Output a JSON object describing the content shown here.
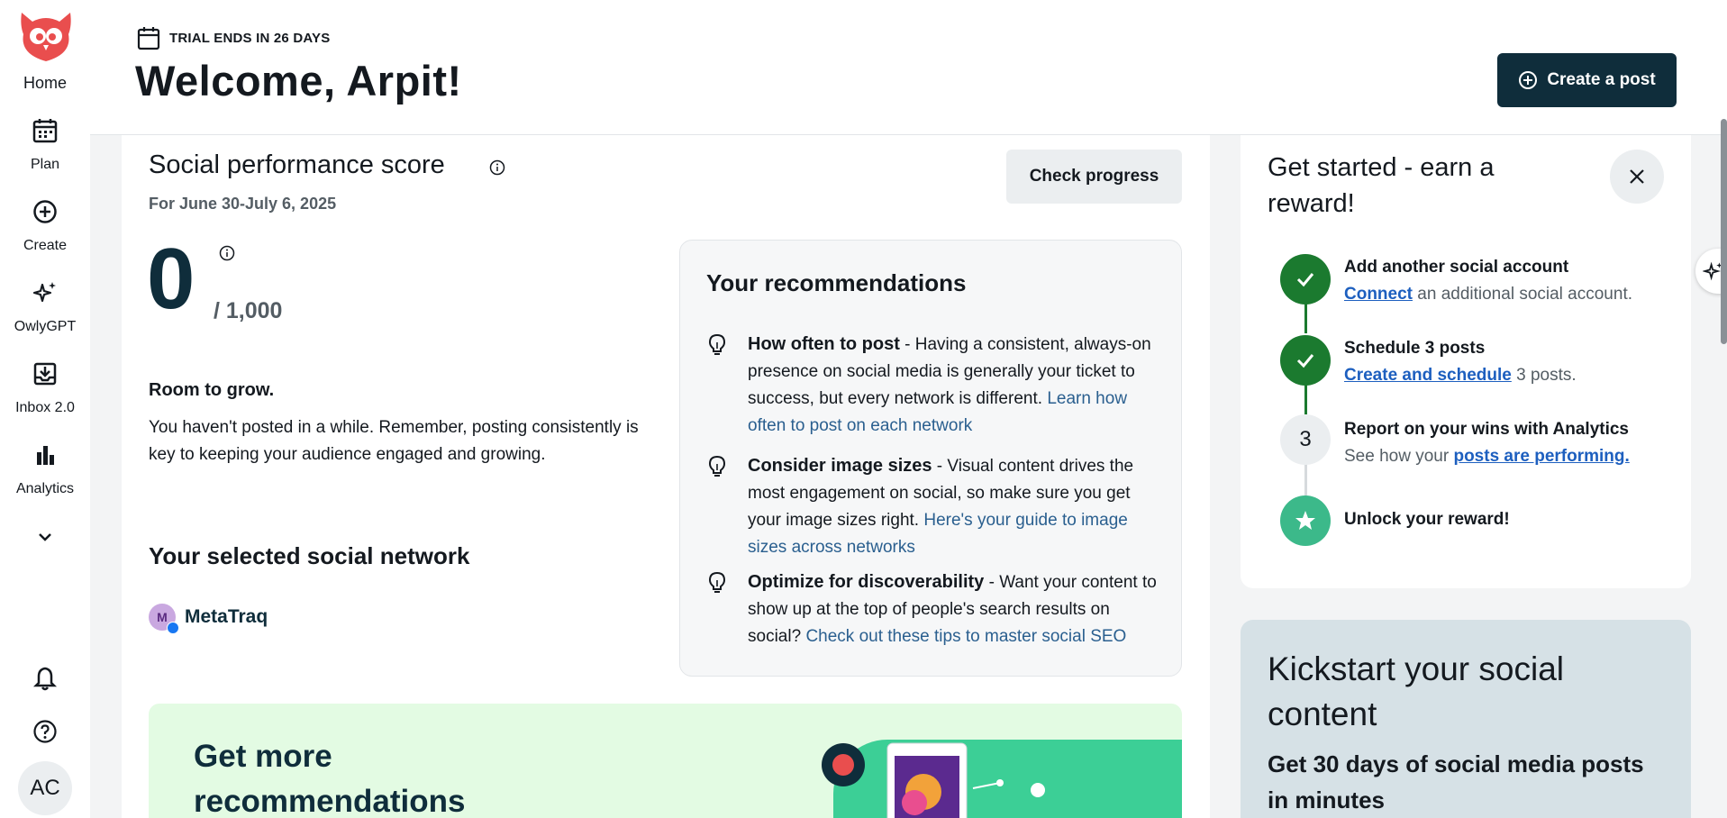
{
  "nav": {
    "home": "Home",
    "items": [
      {
        "label": "Plan",
        "icon": "calendar-icon"
      },
      {
        "label": "Create",
        "icon": "plus-circle-icon"
      },
      {
        "label": "OwlyGPT",
        "icon": "sparkles-icon"
      },
      {
        "label": "Inbox 2.0",
        "icon": "inbox-icon"
      },
      {
        "label": "Analytics",
        "icon": "bar-chart-icon"
      }
    ],
    "avatar_initials": "AC"
  },
  "header": {
    "trial_text": "TRIAL ENDS IN 26 DAYS",
    "welcome": "Welcome, Arpit!",
    "create_post": "Create a post"
  },
  "score": {
    "title": "Social performance score",
    "date_range": "For June 30-July 6, 2025",
    "check_progress": "Check progress",
    "value": "0",
    "max": "/ 1,000",
    "status_title": "Room to grow.",
    "status_desc": "You haven't posted in a while. Remember, posting consistently is key to keeping your audience engaged and growing.",
    "selected_network_title": "Your selected social network",
    "network_initial": "M",
    "network_name": "MetaTraq"
  },
  "recommendations": {
    "title": "Your recommendations",
    "items": [
      {
        "heading": "How often to post",
        "text": "Having a consistent, always-on presence on social media is generally your ticket to success, but every network is different.",
        "link": "Learn how often to post on each network"
      },
      {
        "heading": "Consider image sizes",
        "text": "Visual content drives the most engagement on social, so make sure you get your image sizes right.",
        "link": "Here's your guide to image sizes across networks"
      },
      {
        "heading": "Optimize for discoverability",
        "text": "Want your content to show up at the top of people's search results on social?",
        "link": "Check out these tips to master social SEO"
      }
    ]
  },
  "promo": {
    "title": "Get more recommendations"
  },
  "get_started": {
    "title": "Get started - earn a reward!",
    "steps": [
      {
        "title": "Add another social account",
        "link": "Connect",
        "desc_after": "an additional social account.",
        "state": "done"
      },
      {
        "title": "Schedule 3 posts",
        "link": "Create and schedule",
        "desc_after": "3 posts.",
        "state": "done"
      },
      {
        "number": "3",
        "title": "Report on your wins with Analytics",
        "desc_before": "See how your",
        "link": "posts are performing.",
        "state": "pending"
      },
      {
        "title": "Unlock your reward!",
        "state": "reward"
      }
    ]
  },
  "kickstart": {
    "title": "Kickstart your social content",
    "subtitle": "Get 30 days of social media posts in minutes"
  },
  "colors": {
    "brand_dark": "#0f2d3b",
    "success_green": "#1b7a2f",
    "reward_green": "#3cb98a",
    "link_blue": "#1d5fbf",
    "owl_red": "#e94e4e"
  }
}
